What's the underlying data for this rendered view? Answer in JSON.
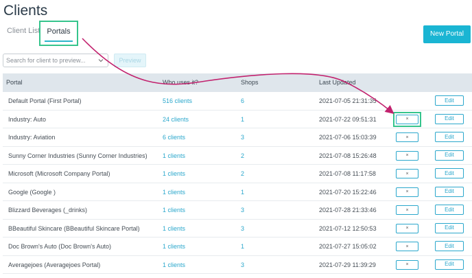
{
  "page": {
    "title": "Clients"
  },
  "tabs": [
    {
      "label": "Client List",
      "active": false
    },
    {
      "label": "Portals",
      "active": true
    }
  ],
  "actions": {
    "new_portal_label": "New Portal",
    "preview_label": "Preview"
  },
  "search": {
    "placeholder": "Search for client to preview...",
    "value": ""
  },
  "colors": {
    "accent": "#1ab5d3",
    "link": "#2aa7cc",
    "highlight": "#35c48c",
    "annotation_arrow": "#c2226e"
  },
  "table": {
    "headers": [
      "Portal",
      "Who uses it?",
      "Shops",
      "Last Updated"
    ],
    "delete_label": "×",
    "edit_label": "Edit",
    "rows": [
      {
        "portal": "Default Portal (First Portal)",
        "who": "516 clients",
        "shops": "6",
        "updated": "2021-07-05 21:31:35",
        "has_delete": false
      },
      {
        "portal": "Industry: Auto",
        "who": "24 clients",
        "shops": "1",
        "updated": "2021-07-22 09:51:31",
        "has_delete": true
      },
      {
        "portal": "Industry: Aviation",
        "who": "6 clients",
        "shops": "3",
        "updated": "2021-07-06 15:03:39",
        "has_delete": true
      },
      {
        "portal": "Sunny Corner Industries (Sunny Corner Industries)",
        "who": "1 clients",
        "shops": "2",
        "updated": "2021-07-08 15:26:48",
        "has_delete": true
      },
      {
        "portal": "Microsoft (Microsoft Company Portal)",
        "who": "1 clients",
        "shops": "2",
        "updated": "2021-07-08 11:17:58",
        "has_delete": true
      },
      {
        "portal": "Google (Google )",
        "who": "1 clients",
        "shops": "1",
        "updated": "2021-07-20 15:22:46",
        "has_delete": true
      },
      {
        "portal": "Blizzard Beverages (_drinks)",
        "who": "1 clients",
        "shops": "3",
        "updated": "2021-07-28 21:33:46",
        "has_delete": true
      },
      {
        "portal": "BBeautiful Skincare (BBeautiful Skincare Portal)",
        "who": "1 clients",
        "shops": "3",
        "updated": "2021-07-12 12:50:53",
        "has_delete": true
      },
      {
        "portal": "Doc Brown's Auto (Doc Brown's Auto)",
        "who": "1 clients",
        "shops": "1",
        "updated": "2021-07-27 15:05:02",
        "has_delete": true
      },
      {
        "portal": "Averagejoes (Averagejoes Portal)",
        "who": "1 clients",
        "shops": "3",
        "updated": "2021-07-29 11:39:29",
        "has_delete": true
      }
    ]
  }
}
